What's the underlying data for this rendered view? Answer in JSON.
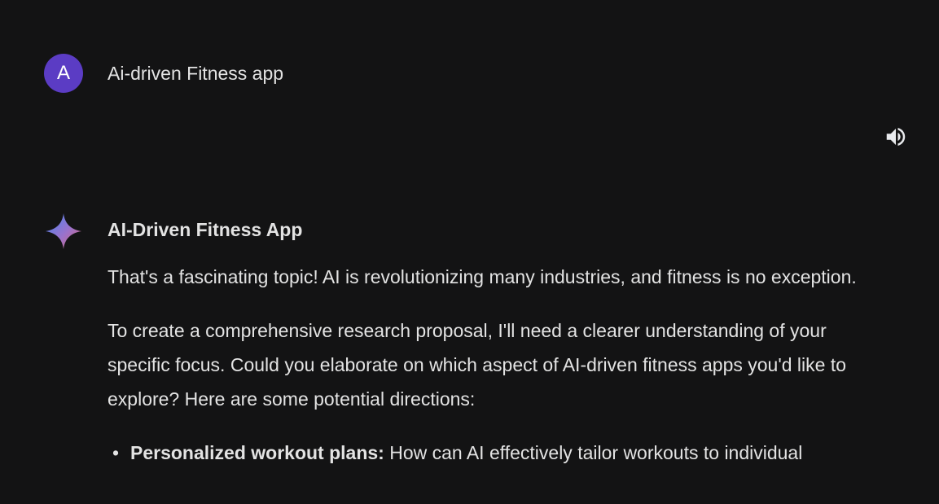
{
  "user_message": {
    "avatar_letter": "A",
    "avatar_color": "#5b3cc4",
    "text": "Ai-driven Fitness app"
  },
  "toolbar": {
    "speaker_icon": "volume-up-icon"
  },
  "response": {
    "icon": "gemini-sparkle-icon",
    "title": "AI-Driven Fitness App",
    "paragraphs": [
      "That's a fascinating topic! AI is revolutionizing many industries, and fitness is no exception.",
      "To create a comprehensive research proposal, I'll need a clearer understanding of your specific focus. Could you elaborate on which aspect of AI-driven fitness apps you'd like to explore? Here are some potential directions:"
    ],
    "bullets": [
      {
        "bold": "Personalized workout plans:",
        "text": " How can AI effectively tailor workouts to individual"
      }
    ]
  },
  "colors": {
    "background": "#131314",
    "text": "#e3e3e3",
    "sparkle_gradient": [
      "#4285f4",
      "#9b72cb",
      "#d96570"
    ]
  }
}
